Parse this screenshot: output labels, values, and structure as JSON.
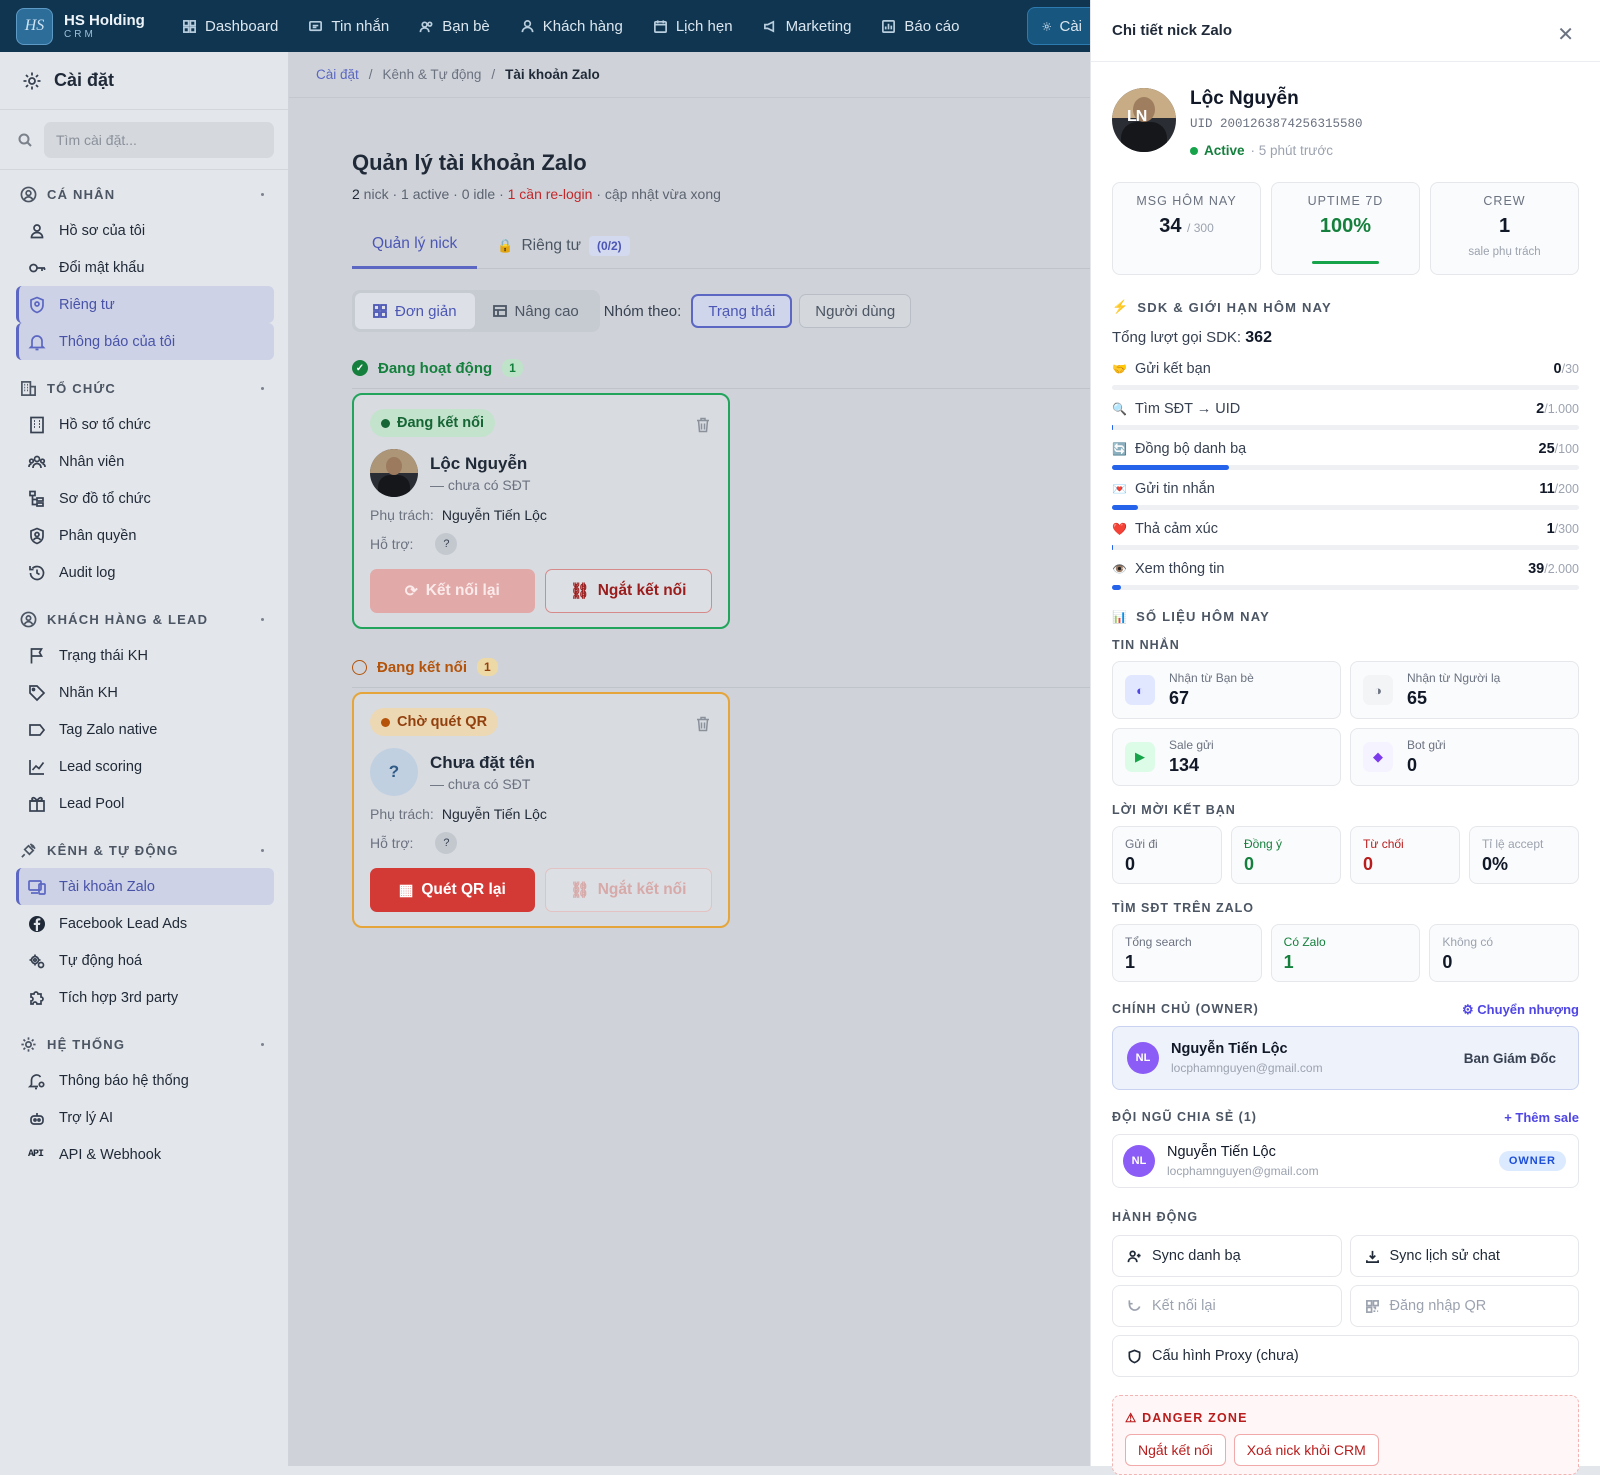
{
  "brand": {
    "name": "HS Holding",
    "sub": "CRM",
    "logo": "HS"
  },
  "nav": [
    {
      "label": "Dashboard",
      "icon": "dashboard-icon"
    },
    {
      "label": "Tin nhắn",
      "icon": "message-icon"
    },
    {
      "label": "Bạn bè",
      "icon": "friends-icon"
    },
    {
      "label": "Khách hàng",
      "icon": "user-icon"
    },
    {
      "label": "Lịch hẹn",
      "icon": "calendar-icon"
    },
    {
      "label": "Marketing",
      "icon": "megaphone-icon"
    },
    {
      "label": "Báo cáo",
      "icon": "report-icon"
    },
    {
      "label": "Cài",
      "icon": "gear-icon"
    }
  ],
  "sidebar": {
    "title": "Cài đặt",
    "search_placeholder": "Tìm cài đặt...",
    "sections": [
      {
        "title": "CÁ NHÂN",
        "items": [
          "Hồ sơ của tôi",
          "Đổi mật khẩu",
          "Riêng tư",
          "Thông báo của tôi"
        ]
      },
      {
        "title": "TỔ CHỨC",
        "items": [
          "Hồ sơ tổ chức",
          "Nhân viên",
          "Sơ đồ tổ chức",
          "Phân quyền",
          "Audit log"
        ]
      },
      {
        "title": "KHÁCH HÀNG & LEAD",
        "items": [
          "Trạng thái KH",
          "Nhãn KH",
          "Tag Zalo native",
          "Lead scoring",
          "Lead Pool"
        ]
      },
      {
        "title": "KÊNH & TỰ ĐỘNG",
        "items": [
          "Tài khoản Zalo",
          "Facebook Lead Ads",
          "Tự động hoá",
          "Tích hợp 3rd party"
        ]
      },
      {
        "title": "HỆ THỐNG",
        "items": [
          "Thông báo hệ thống",
          "Trợ lý AI",
          "API & Webhook"
        ]
      }
    ],
    "api_glyph": "API"
  },
  "breadcrumb": {
    "a": "Cài đặt",
    "b": "Kênh & Tự động",
    "c": "Tài khoản Zalo",
    "sep": "/"
  },
  "page": {
    "title": "Quản lý tài khoản Zalo",
    "sub_n": "2",
    "sub_a": " nick · 1 active · 0 idle · ",
    "sub_red": "1 cần re-login",
    "sub_b": " · cập nhật vừa xong",
    "tabs": {
      "t1": "Quản lý nick",
      "t2": "Riêng tư",
      "t2_count": "(0/2)"
    },
    "view": {
      "simple": "Đơn giản",
      "advanced": "Nâng cao",
      "group_by": "Nhóm theo:",
      "status": "Trạng thái",
      "user": "Người dùng"
    },
    "group1": {
      "title": "Đang hoạt động",
      "count": "1"
    },
    "group2": {
      "title": "Đang kết nối",
      "count": "1"
    },
    "card1": {
      "badge": "Đang kết nối",
      "name": "Lộc Nguyễn",
      "phone": "— chưa có SĐT",
      "owner_label": "Phụ trách:",
      "owner": "Nguyễn Tiến Lộc",
      "support_label": "Hỗ trợ:",
      "q": "?",
      "btn1": "Kết nối lại",
      "btn2": "Ngắt kết nối"
    },
    "card2": {
      "badge": "Chờ quét QR",
      "name": "Chưa đặt tên",
      "phone": "— chưa có SĐT",
      "owner_label": "Phụ trách:",
      "owner": "Nguyễn Tiến Lộc",
      "support_label": "Hỗ trợ:",
      "q": "?",
      "avatar": "?",
      "btn1": "Quét QR lại",
      "btn2": "Ngắt kết nối"
    }
  },
  "panel": {
    "title": "Chi tiết nick Zalo",
    "close": "✕",
    "name": "Lộc Nguyễn",
    "avatar_text": "LN",
    "uid": "UID 2001263874256315580",
    "status": "Active",
    "last": "· 5 phút trước",
    "stats": [
      {
        "label": "MSG HÔM NAY",
        "value": "34",
        "small": "/ 300",
        "sub": ""
      },
      {
        "label": "UPTIME 7D",
        "value": "100%",
        "small": "",
        "sub": ""
      },
      {
        "label": "CREW",
        "value": "1",
        "small": "",
        "sub": "sale phụ trách"
      }
    ],
    "sdk_title": "SDK & GIỚI HẠN HÔM NAY",
    "sdk_total_label": "Tổng lượt gọi SDK:",
    "sdk_total": "362",
    "limits": [
      {
        "icon": "🤝",
        "label": "Gửi kết bạn",
        "used": "0",
        "max": "/30",
        "pct": 0
      },
      {
        "icon": "🔍",
        "label": "Tìm SĐT → UID",
        "used": "2",
        "max": "/1.000",
        "pct": 0.2
      },
      {
        "icon": "🔄",
        "label": "Đồng bộ danh bạ",
        "used": "25",
        "max": "/100",
        "pct": 25
      },
      {
        "icon": "💌",
        "label": "Gửi tin nhắn",
        "used": "11",
        "max": "/200",
        "pct": 5.5
      },
      {
        "icon": "❤️",
        "label": "Thả cảm xúc",
        "used": "1",
        "max": "/300",
        "pct": 0.3
      },
      {
        "icon": "👁️",
        "label": "Xem thông tin",
        "used": "39",
        "max": "/2.000",
        "pct": 2
      }
    ],
    "today_title": "SỐ LIỆU HÔM NAY",
    "msg_title": "TIN NHẮN",
    "msgs": [
      {
        "label": "Nhận từ Bạn bè",
        "value": "67",
        "icon": "◐"
      },
      {
        "label": "Nhận từ Người lạ",
        "value": "65",
        "icon": "◑"
      },
      {
        "label": "Sale gửi",
        "value": "134",
        "icon": "▶"
      },
      {
        "label": "Bot gửi",
        "value": "0",
        "icon": "◆"
      }
    ],
    "fr_title": "LỜI MỜI KẾT BẠN",
    "friends": [
      {
        "label": "Gửi đi",
        "value": "0"
      },
      {
        "label": "Đồng ý",
        "value": "0"
      },
      {
        "label": "Từ chối",
        "value": "0"
      },
      {
        "label": "Tỉ lệ accept",
        "value": "0%"
      }
    ],
    "search_title": "TÌM SĐT TRÊN ZALO",
    "search": [
      {
        "label": "Tổng search",
        "value": "1"
      },
      {
        "label": "Có Zalo",
        "value": "1"
      },
      {
        "label": "Không có",
        "value": "0"
      }
    ],
    "owner_title": "CHÍNH CHỦ (OWNER)",
    "owner_link": "⚙ Chuyển nhượng",
    "owner": {
      "init": "NL",
      "name": "Nguyễn Tiến Lộc",
      "email": "locphamnguyen@gmail.com",
      "role": "Ban Giám Đốc"
    },
    "team_title": "ĐỘI NGŨ CHIA SẺ (1)",
    "team_link": "+ Thêm sale",
    "member": {
      "init": "NL",
      "name": "Nguyễn Tiến Lộc",
      "email": "locphamnguyen@gmail.com",
      "badge": "OWNER"
    },
    "actions_title": "HÀNH ĐỘNG",
    "actions": {
      "a1": "Sync danh bạ",
      "a2": "Sync lịch sử chat",
      "a3": "Kết nối lại",
      "a4": "Đăng nhập QR",
      "a5": "Cấu hình Proxy (chưa)"
    },
    "danger_title": "⚠ DANGER ZONE",
    "danger": {
      "d1": "Ngắt kết nối",
      "d2": "Xoá nick khỏi CRM"
    }
  }
}
